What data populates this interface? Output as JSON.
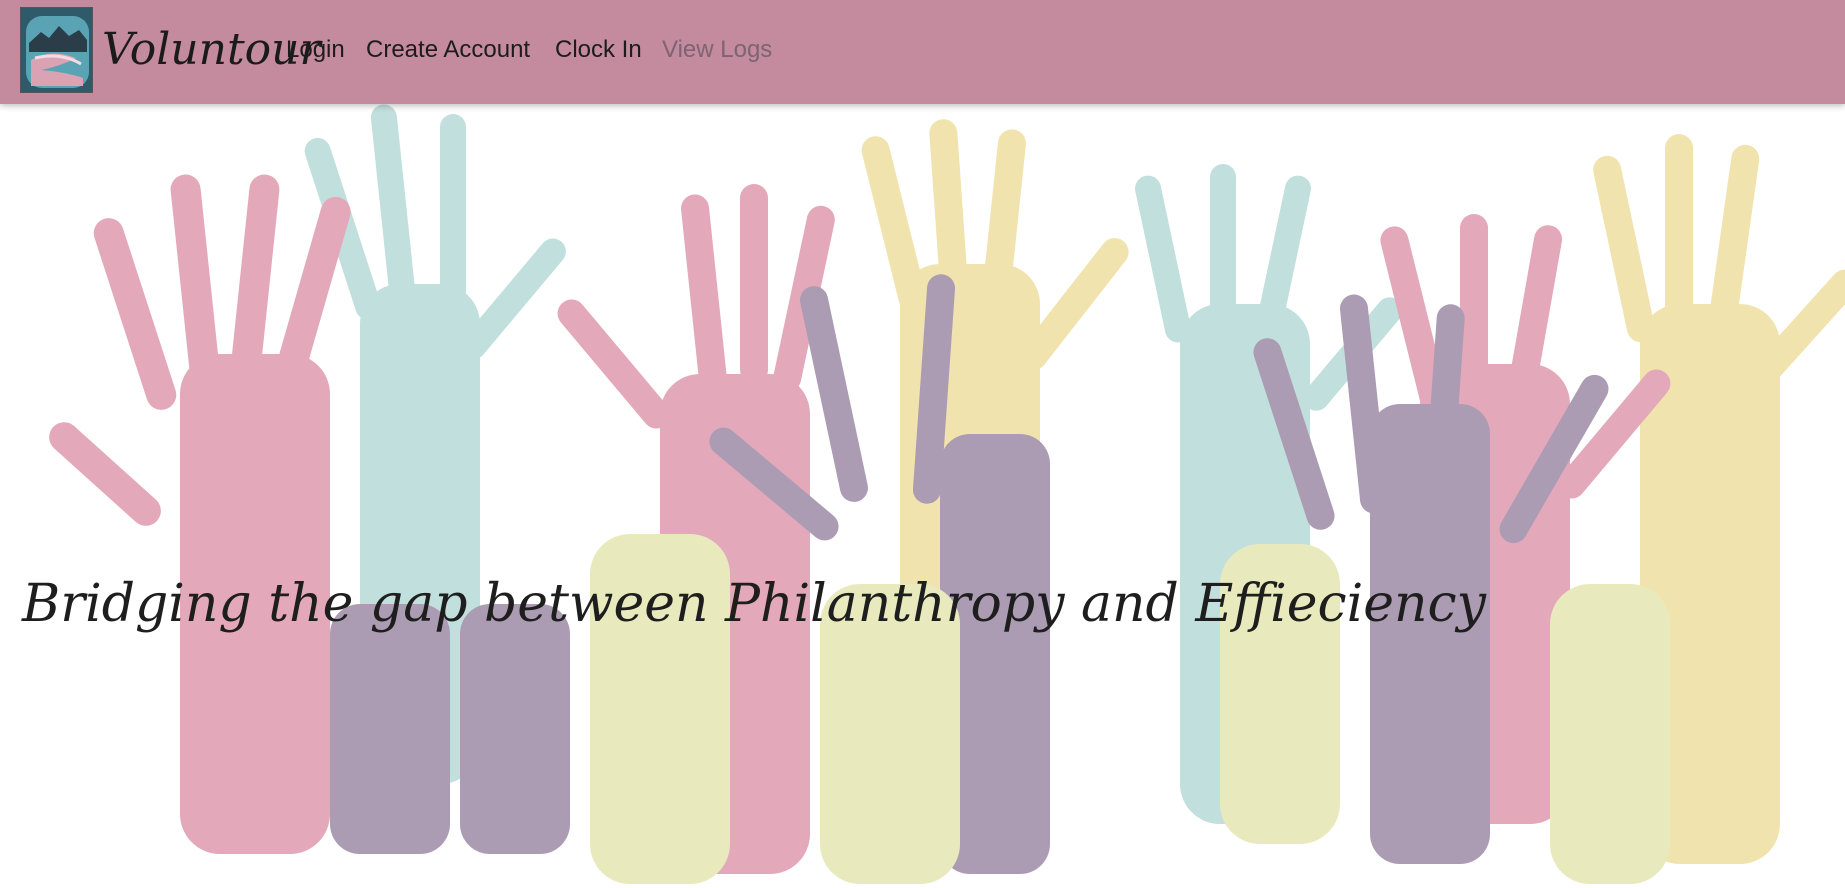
{
  "app": {
    "brand": "Voluntour"
  },
  "nav": {
    "login": "Login",
    "create_account": "Create Account",
    "clock_in": "Clock In",
    "view_logs": "View Logs"
  },
  "hero": {
    "tagline": "Bridging the gap between Philanthropy and Effieciency",
    "image": "raised-hands-illustration"
  },
  "colors": {
    "navbar": "#c48a9e",
    "hand_pink": "#d9879f",
    "hand_teal": "#a9d3d0",
    "hand_yellow": "#ecd98f",
    "hand_purple": "#8c7595",
    "hand_lime": "#dfe2a4"
  }
}
